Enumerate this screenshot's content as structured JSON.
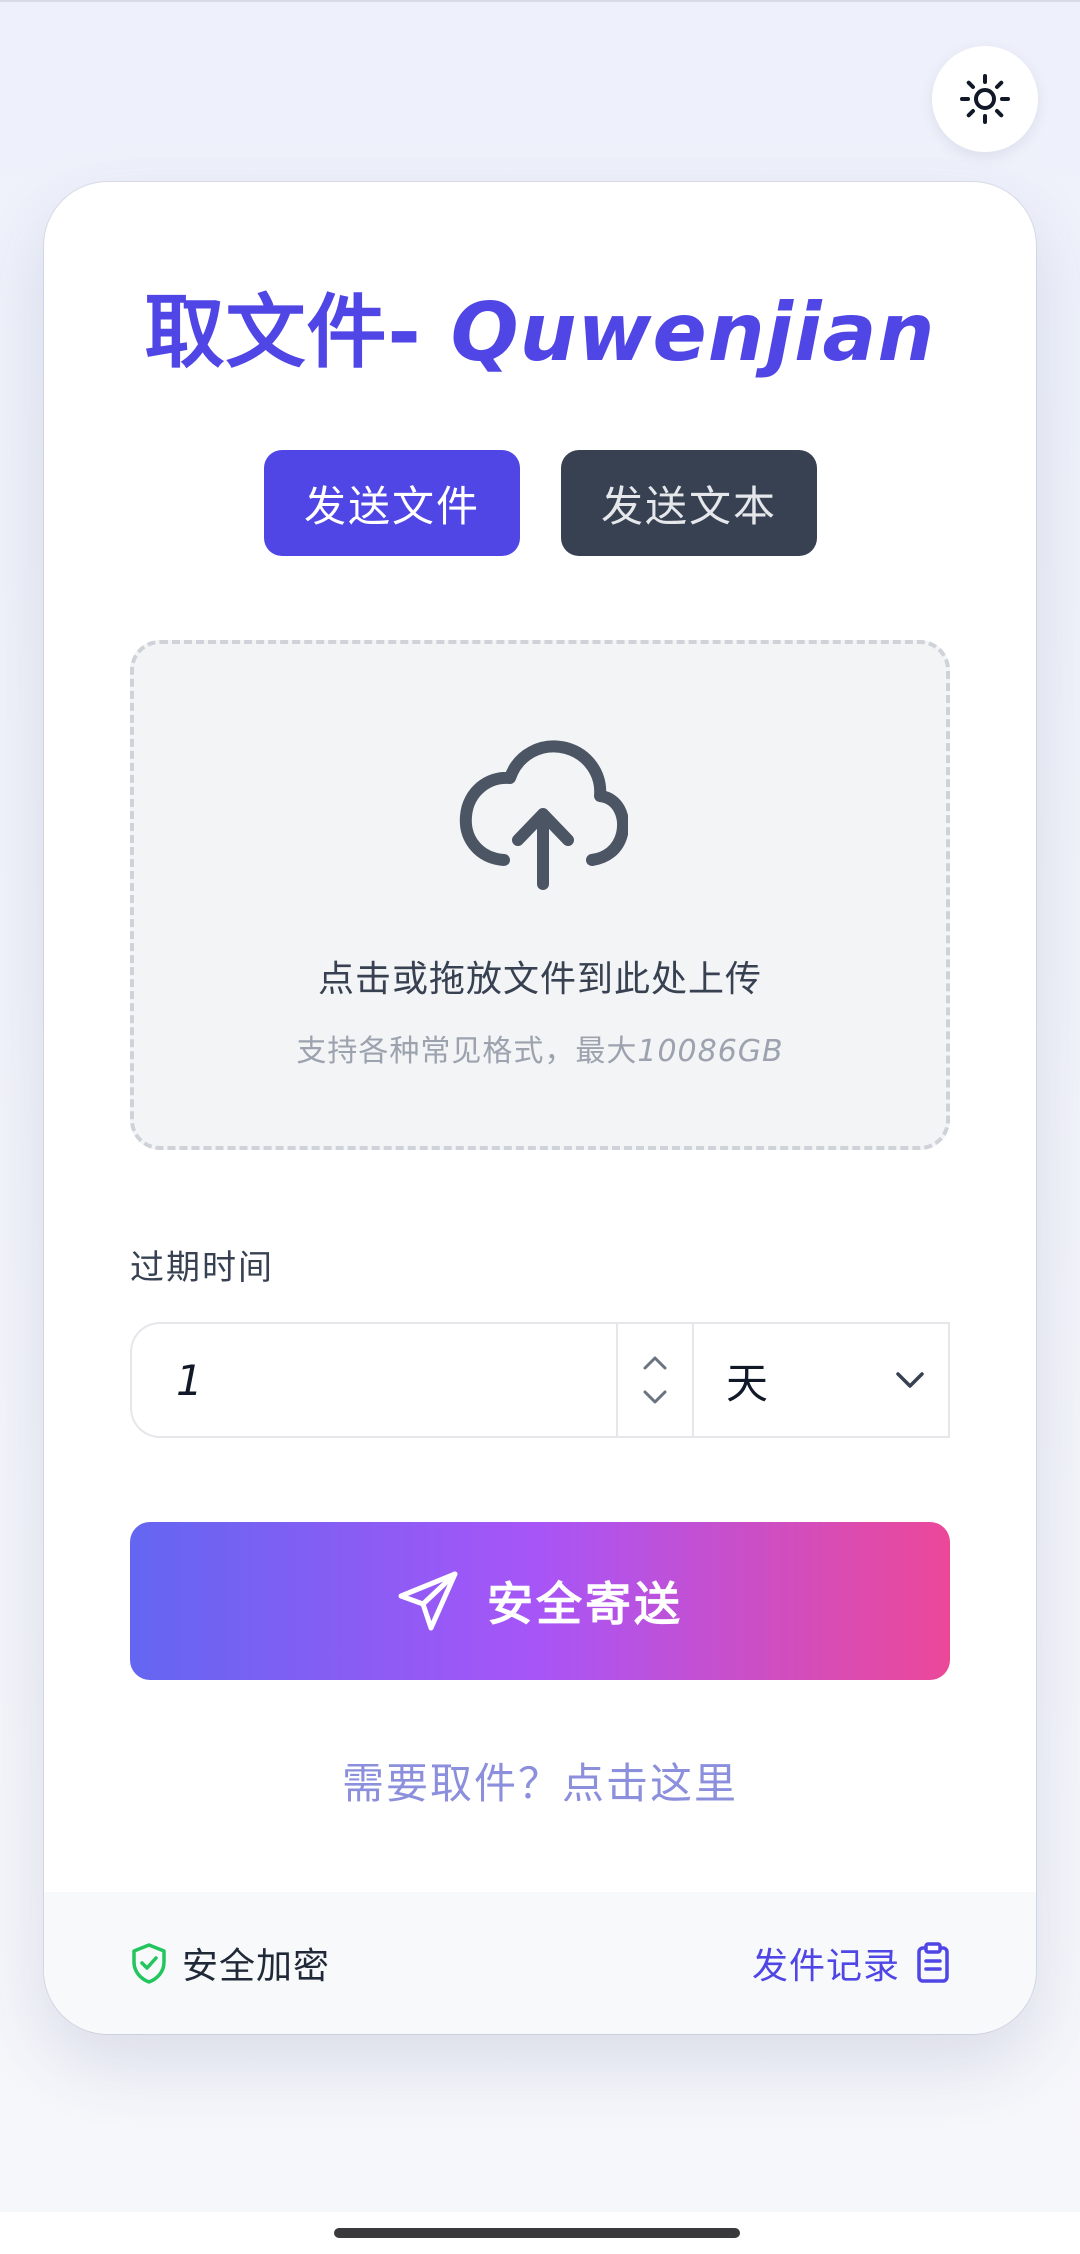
{
  "header": {
    "theme_icon": "sun-icon"
  },
  "card": {
    "title_cn": "取文件- ",
    "title_latin": "Quwenjian",
    "tabs": [
      {
        "label": "发送文件",
        "active": true
      },
      {
        "label": "发送文本",
        "active": false
      }
    ],
    "dropzone": {
      "icon": "cloud-upload-icon",
      "main_text": "点击或拖放文件到此处上传",
      "sub_text": "支持各种常见格式，最大",
      "max_size": "10086GB"
    },
    "expire": {
      "label": "过期时间",
      "value": "1",
      "unit": "天"
    },
    "send_button": {
      "label": "安全寄送",
      "icon": "paper-plane-icon"
    },
    "pickup_link": "需要取件？点击这里",
    "footer": {
      "secure_text": "安全加密",
      "secure_icon": "shield-check-icon",
      "records_text": "发件记录",
      "records_icon": "clipboard-icon"
    }
  },
  "colors": {
    "primary": "#4f46e5",
    "dark_tab": "#374151",
    "gradient_start": "#6366f1",
    "gradient_mid": "#a855f7",
    "gradient_end": "#ec4899",
    "link": "#8b8fdc",
    "secure_green": "#22c55e"
  }
}
